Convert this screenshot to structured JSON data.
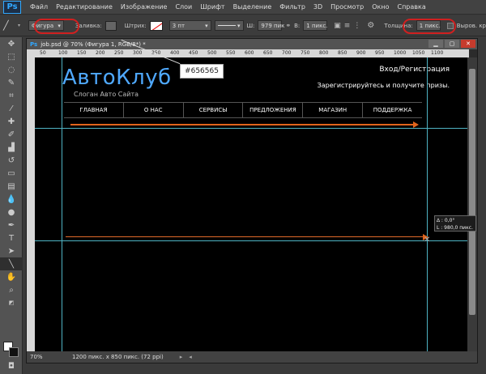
{
  "app": {
    "logo": "Ps",
    "doc_title": "job.psd @ 70% (Фигура 1, RGB/8*) *"
  },
  "menu": [
    "Файл",
    "Редактирование",
    "Изображение",
    "Слои",
    "Шрифт",
    "Выделение",
    "Фильтр",
    "3D",
    "Просмотр",
    "Окно",
    "Справка"
  ],
  "options": {
    "mode": "Фигура",
    "fill_label": "Заливка:",
    "stroke_label": "Штрих:",
    "stroke_width": "3 пт",
    "w_label": "Ш:",
    "w_value": "979 пик",
    "h_label": "В:",
    "h_value": "1 пикс.",
    "weight_label": "Толщина:",
    "weight_value": "1 пикс.",
    "align_label": "Выров. кр"
  },
  "callout": "#656565",
  "ruler_ticks": [
    "50",
    "100",
    "150",
    "200",
    "250",
    "300",
    "350",
    "400",
    "450",
    "500",
    "550",
    "600",
    "650",
    "700",
    "750",
    "800",
    "850",
    "900",
    "950",
    "1000",
    "1050",
    "1100"
  ],
  "site": {
    "logo": "АвтоКлуб",
    "slogan": "Слоган  Авто Сайта",
    "login": "Вход/Регистрация",
    "register": "Зарегистрируйтесь и получите призы.",
    "nav": [
      "ГЛАВНАЯ",
      "О НАС",
      "СЕРВИСЫ",
      "ПРЕДЛОЖЕНИЯ",
      "МАГАЗИН",
      "ПОДДЕРЖКА"
    ]
  },
  "info": {
    "angle": "∆ :          0,0°",
    "length": "L : 980,0 пикс."
  },
  "status": {
    "zoom": "70%",
    "size": "1200 пикс. x 850 пикс. (72 ppi)"
  },
  "colors": {
    "fill": "#656565",
    "accent": "#4fa9ff",
    "guide": "#4fb3c4",
    "line": "#e0641c",
    "highlight": "#d02020"
  }
}
